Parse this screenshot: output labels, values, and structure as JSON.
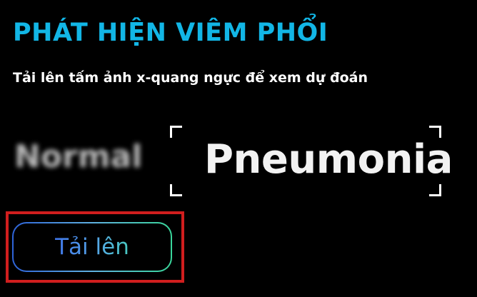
{
  "header": {
    "title": "PHÁT HIỆN VIÊM PHỔI",
    "subtitle": "Tải lên tấm ảnh x-quang ngực để xem dự đoán"
  },
  "prediction": {
    "inactive_label": "Normal",
    "active_label": "Pneumonia"
  },
  "upload": {
    "button_label": "Tải lên"
  },
  "colors": {
    "background": "#000000",
    "title": "#12b6e6",
    "text": "#ffffff",
    "button_gradient_start": "#2e63d8",
    "button_gradient_end": "#39d69a",
    "highlight": "#d01e1e"
  }
}
